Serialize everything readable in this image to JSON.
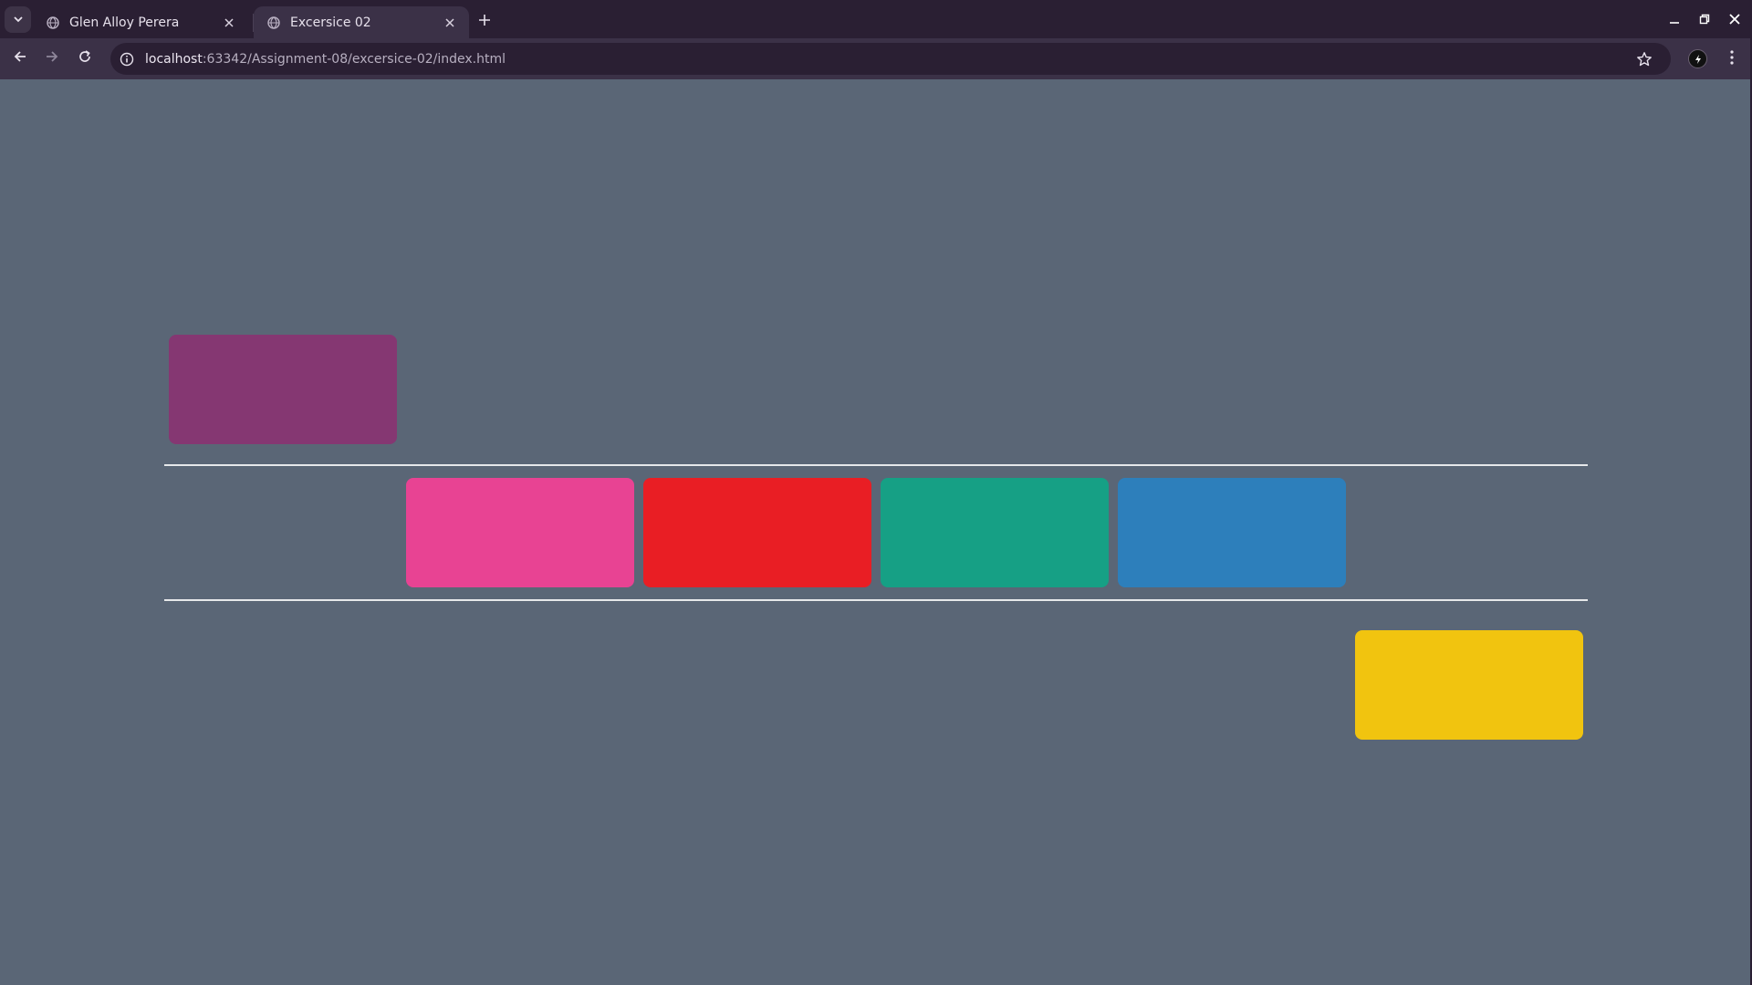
{
  "browser": {
    "tabs": [
      {
        "title": "Glen Alloy Perera",
        "active": false
      },
      {
        "title": "Excersice 02",
        "active": true
      }
    ],
    "address": {
      "host": "localhost",
      "path": ":63342/Assignment-08/excersice-02/index.html"
    },
    "icons": {
      "tab_search": "chevron-down-icon",
      "favicon": "globe-icon",
      "close": "close-icon",
      "new_tab": "plus-icon",
      "back": "arrow-left-icon",
      "forward": "arrow-right-icon",
      "reload": "reload-icon",
      "site_info": "info-icon",
      "bookmark": "star-icon",
      "extension": "extension-icon",
      "menu": "kebab-menu-icon",
      "minimize": "minimize-icon",
      "restore": "restore-icon",
      "window_close": "close-icon"
    }
  },
  "page": {
    "background": "#5a6676",
    "rule_color": "#e6e8ea",
    "boxes": [
      {
        "name": "purple-box",
        "color": "#853772"
      },
      {
        "name": "pink-box",
        "color": "#e84393"
      },
      {
        "name": "red-box",
        "color": "#e91e24"
      },
      {
        "name": "teal-box",
        "color": "#16a085"
      },
      {
        "name": "blue-box",
        "color": "#2d7fbb"
      },
      {
        "name": "yellow-box",
        "color": "#f1c40f"
      }
    ]
  }
}
